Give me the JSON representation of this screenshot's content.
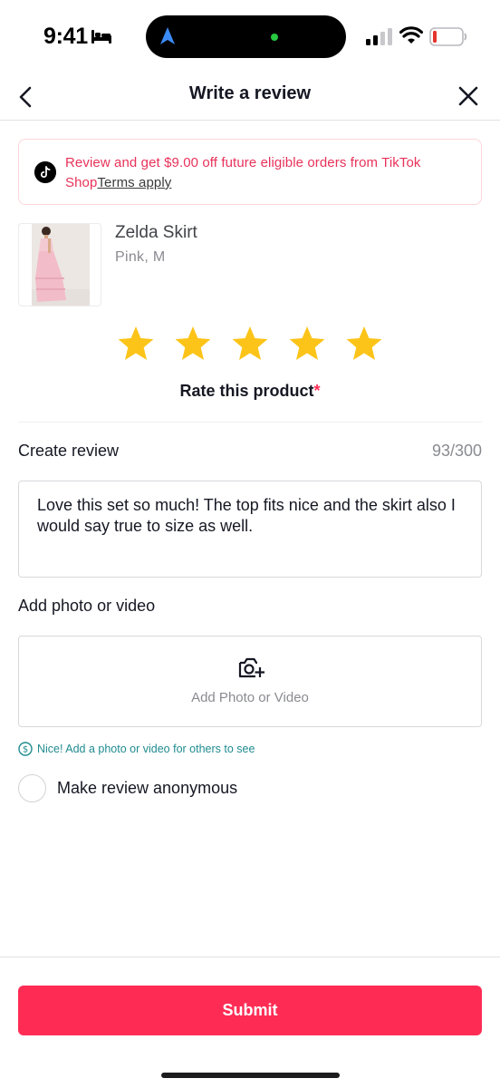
{
  "status_bar": {
    "time": "9:41",
    "icons": [
      "bed-icon",
      "location-arrow-icon",
      "signal-icon",
      "wifi-icon",
      "battery-icon"
    ]
  },
  "header": {
    "title": "Write a review",
    "back_icon": "chevron-left-icon",
    "close_icon": "close-icon"
  },
  "promo": {
    "text": "Review and get $9.00 off future eligible orders from TikTok Shop",
    "link": "Terms apply",
    "icon": "tiktok-logo-icon",
    "accent": "#e8325a"
  },
  "product": {
    "name": "Zelda Skirt",
    "variant": "Pink, M"
  },
  "rating": {
    "stars_selected": 5,
    "stars_total": 5,
    "label": "Rate this product",
    "required_mark": "*",
    "star_color": "#fcc419"
  },
  "review": {
    "label": "Create review",
    "counter": "93/300",
    "text": "Love this set so much! The top fits nice and the skirt also I would say true to size as well."
  },
  "media": {
    "label": "Add photo or video",
    "button_label": "Add Photo or Video",
    "icon": "camera-plus-icon",
    "tip": "Nice! Add a photo or video for others to see",
    "tip_icon": "coin-icon"
  },
  "anonymous": {
    "label": "Make review anonymous",
    "checked": false
  },
  "footer": {
    "submit_label": "Submit",
    "submit_color": "#fe2c55"
  }
}
